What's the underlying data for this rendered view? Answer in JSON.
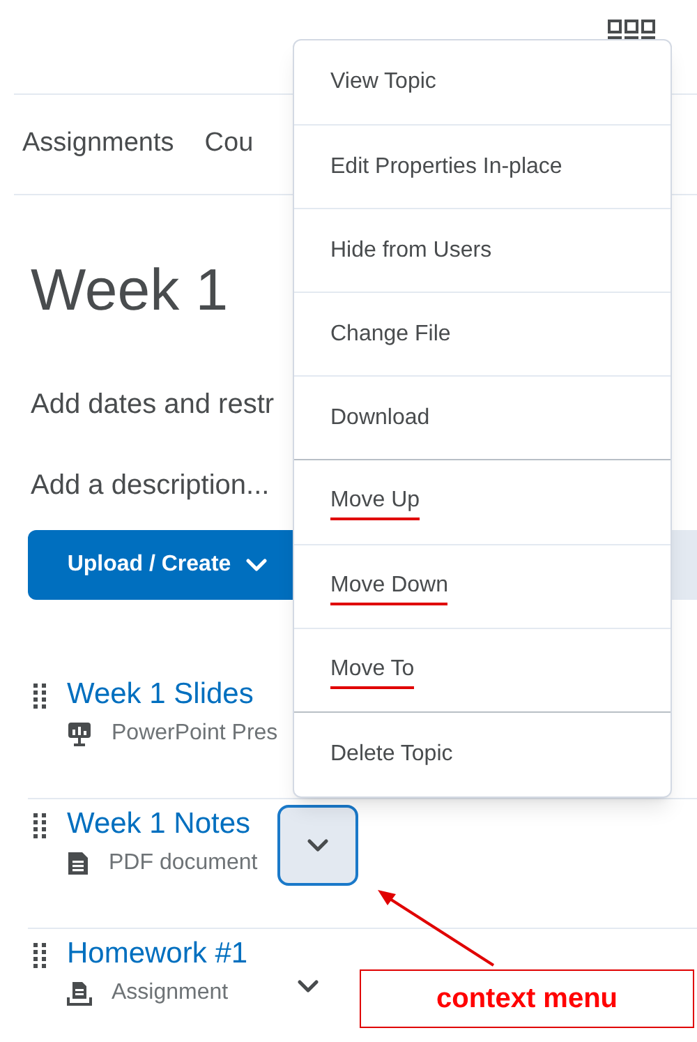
{
  "nav_tabs": [
    {
      "label": "Assignments"
    },
    {
      "label": "Cou"
    }
  ],
  "title": "Week 1",
  "add_dates_link": "Add dates and restr",
  "description_placeholder": "Add a description...",
  "upload_button": {
    "label": "Upload / Create"
  },
  "topics": [
    {
      "title": "Week 1 Slides",
      "type": "PowerPoint Pres",
      "kind": "presentation"
    },
    {
      "title": "Week 1 Notes",
      "type": "PDF document",
      "kind": "document",
      "menu_button": {
        "focused": true
      }
    },
    {
      "title": "Homework #1",
      "type": "Assignment",
      "kind": "assignment",
      "menu_button": {
        "focused": false
      }
    }
  ],
  "context_menu_groups": [
    [
      {
        "label": "View Topic",
        "underlined": false
      },
      {
        "label": "Edit Properties In-place",
        "underlined": false
      },
      {
        "label": "Hide from Users",
        "underlined": false
      },
      {
        "label": "Change File",
        "underlined": false
      },
      {
        "label": "Download",
        "underlined": false
      }
    ],
    [
      {
        "label": "Move Up",
        "underlined": true
      },
      {
        "label": "Move Down",
        "underlined": true
      },
      {
        "label": "Move To",
        "underlined": true
      }
    ],
    [
      {
        "label": "Delete Topic",
        "underlined": false
      }
    ]
  ],
  "annotation": {
    "label": "context menu"
  }
}
